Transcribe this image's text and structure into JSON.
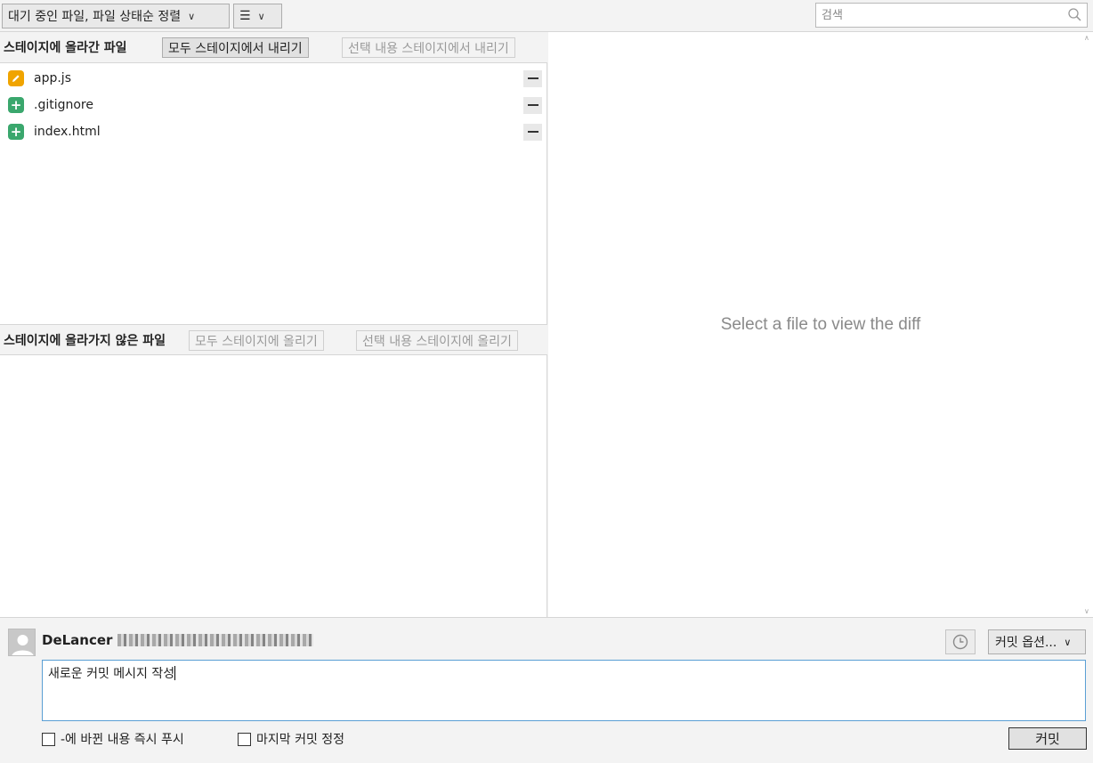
{
  "toolbar": {
    "sort_dropdown": "대기 중인 파일, 파일 상태순 정렬",
    "view_dropdown_glyph": "☰",
    "search_placeholder": "검색"
  },
  "staged": {
    "title": "스테이지에 올라간 파일",
    "unstage_all": "모두 스테이지에서 내리기",
    "unstage_selected": "선택 내용 스테이지에서 내리기",
    "files": [
      {
        "name": "app.js",
        "status": "modified",
        "icon": "pencil-icon",
        "color": "#f0a400"
      },
      {
        "name": ".gitignore",
        "status": "added",
        "icon": "plus-icon",
        "color": "#3aa76d"
      },
      {
        "name": "index.html",
        "status": "added",
        "icon": "plus-icon",
        "color": "#3aa76d"
      }
    ]
  },
  "unstaged": {
    "title": "스테이지에 올라가지 않은 파일",
    "stage_all": "모두 스테이지에 올리기",
    "stage_selected": "선택 내용 스테이지에 올리기"
  },
  "diff": {
    "placeholder": "Select a file to view the diff"
  },
  "commit": {
    "author": "DeLancer",
    "options_label": "커밋 옵션...",
    "message_placeholder": "새로운 커밋 메시지 작성",
    "push_checkbox": "-에 바뀐 내용 즉시 푸시",
    "amend_checkbox": "마지막 커밋 정정",
    "commit_button": "커밋"
  },
  "colors": {
    "accent_border": "#5a9fd4",
    "modified": "#f0a400",
    "added": "#3aa76d"
  }
}
